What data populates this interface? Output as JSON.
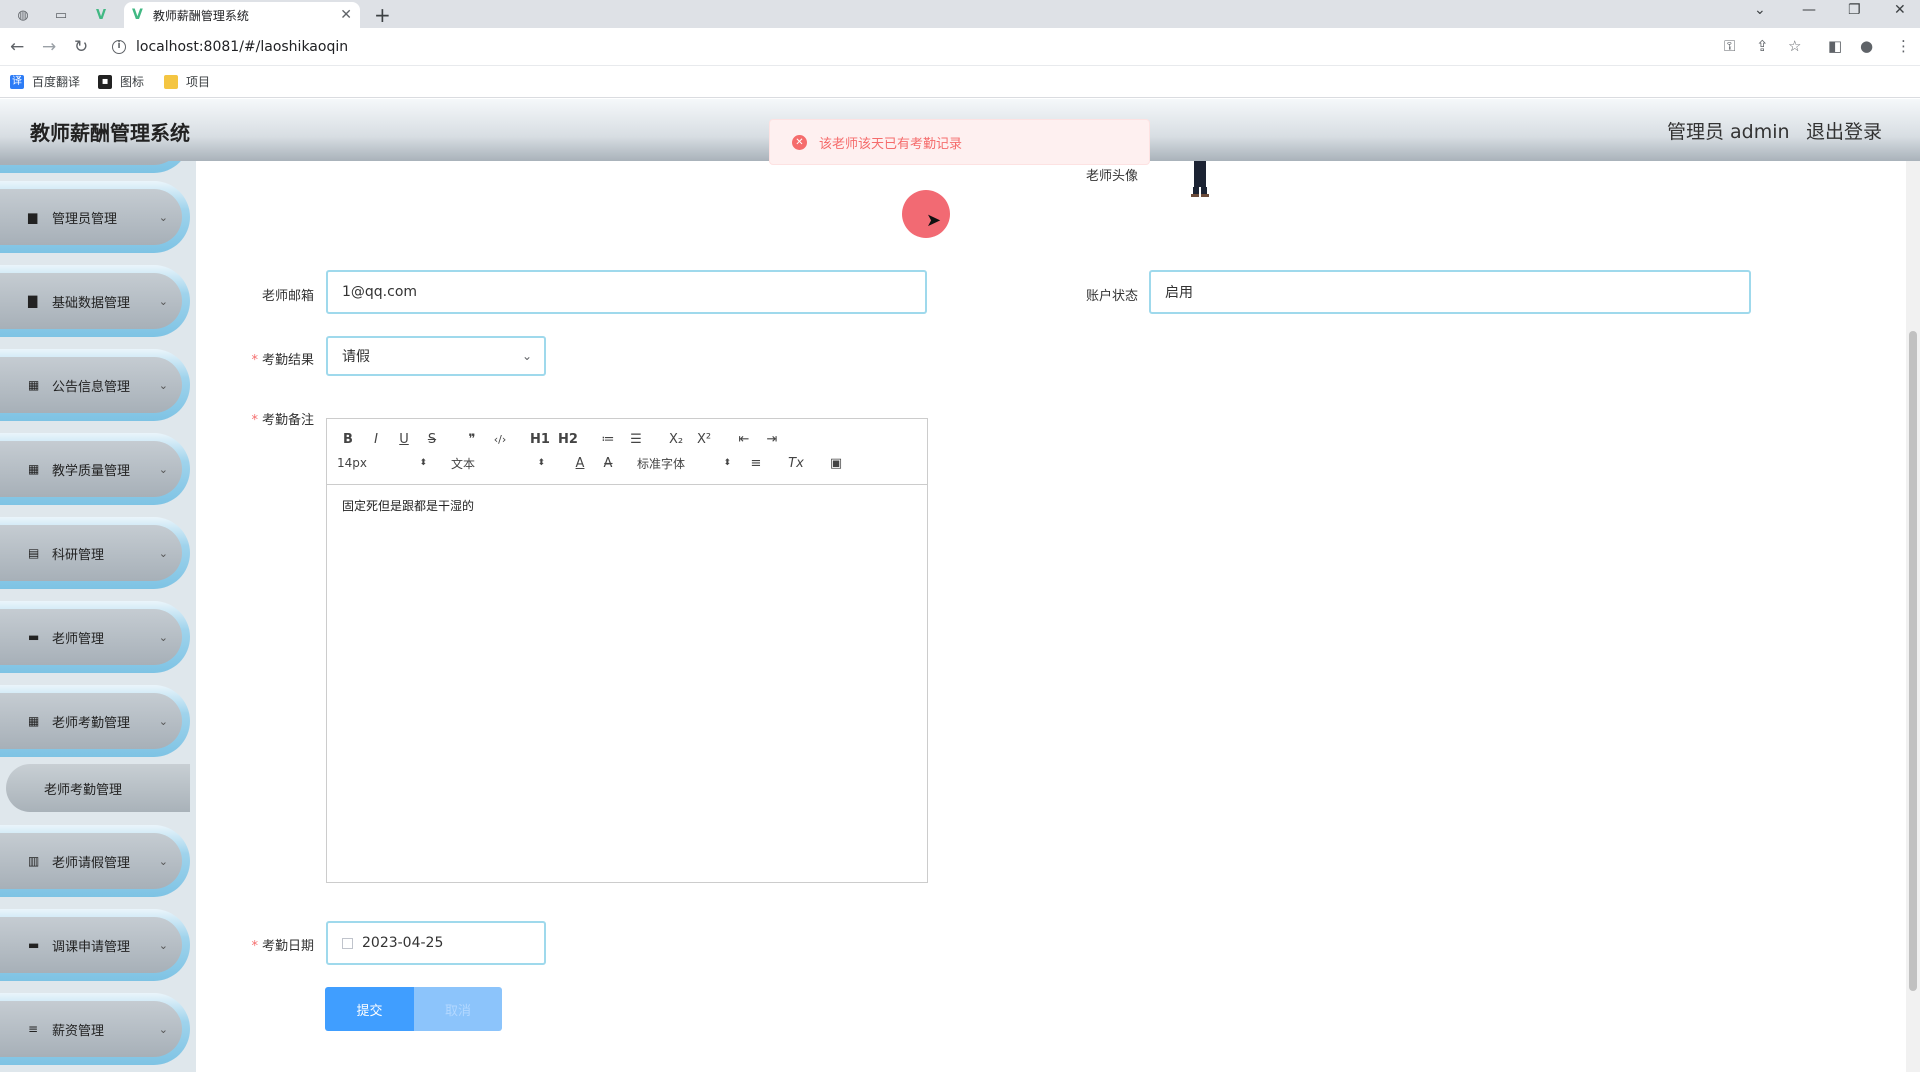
{
  "browser": {
    "tab_title": "教师薪酬管理系统",
    "url": "localhost:8081/#/laoshikaoqin",
    "bookmarks": [
      "百度翻译",
      "图标",
      "项目"
    ]
  },
  "header": {
    "title": "教师薪酬管理系统",
    "admin_label": "管理员 admin",
    "logout_label": "退出登录"
  },
  "toast": {
    "message": "该老师该天已有考勤记录",
    "color": "#f56c6c"
  },
  "sidebar": {
    "items": [
      {
        "label": "管理员管理",
        "icon": "briefcase-icon"
      },
      {
        "label": "基础数据管理",
        "icon": "clipboard-icon"
      },
      {
        "label": "公告信息管理",
        "icon": "grid-icon"
      },
      {
        "label": "教学质量管理",
        "icon": "grid-icon"
      },
      {
        "label": "科研管理",
        "icon": "document-icon"
      },
      {
        "label": "老师管理",
        "icon": "monitor-icon"
      },
      {
        "label": "老师考勤管理",
        "icon": "grid-icon"
      },
      {
        "label": "老师请假管理",
        "icon": "chart-icon"
      },
      {
        "label": "调课申请管理",
        "icon": "monitor-icon"
      },
      {
        "label": "薪资管理",
        "icon": "sliders-icon"
      }
    ],
    "active_sub": "老师考勤管理"
  },
  "form": {
    "avatar_label": "老师头像",
    "email_label": "老师邮箱",
    "email_value": "1@qq.com",
    "status_label": "账户状态",
    "status_value": "启用",
    "result_label": "考勤结果",
    "result_value": "请假",
    "remark_label": "考勤备注",
    "remark_value": "固定死但是跟都是干湿的",
    "date_label": "考勤日期",
    "date_value": "2023-04-25",
    "submit_label": "提交",
    "cancel_label": "取消"
  },
  "editor": {
    "font_size": "14px",
    "text_style": "文本",
    "font_family": "标准字体",
    "buttons_row1": [
      "B",
      "I",
      "U",
      "S",
      "❞",
      "‹/›",
      "H1",
      "H2",
      "≔",
      "☰",
      "X₂",
      "X²",
      "⇤",
      "⇥"
    ],
    "buttons_row2_extra": [
      "A",
      "A̶",
      "≡",
      "Tx",
      "▣"
    ]
  }
}
